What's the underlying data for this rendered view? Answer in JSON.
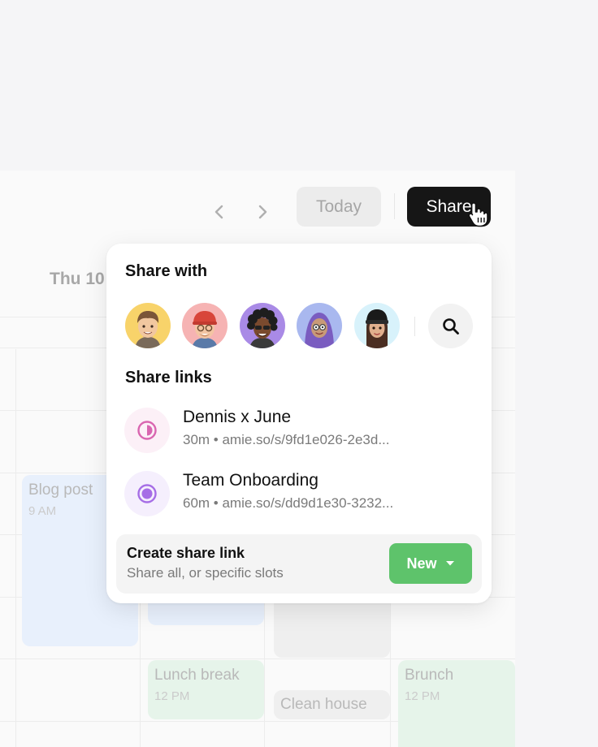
{
  "toolbar": {
    "today_label": "Today",
    "share_label": "Share"
  },
  "calendar": {
    "day_label": "Thu 10",
    "events": [
      {
        "title": "Blog post",
        "time": "9 AM",
        "color": "#e8f0fc"
      },
      {
        "title": "Lunch break",
        "time": "12 PM",
        "color": "#e6f4ea"
      },
      {
        "title": "Clean house",
        "time": "",
        "color": "#efefef"
      },
      {
        "title": "Brunch",
        "time": "12 PM",
        "color": "#e6f4ea"
      }
    ]
  },
  "popover": {
    "share_with_title": "Share with",
    "avatars": [
      {
        "icon": "memoji-man-avatar",
        "bg": "#f8d36a"
      },
      {
        "icon": "memoji-red-cap-avatar",
        "bg": "#f6b3b3"
      },
      {
        "icon": "memoji-curly-hair-avatar",
        "bg": "#a98ae6"
      },
      {
        "icon": "memoji-hijab-avatar",
        "bg": "#a9b8ef"
      },
      {
        "icon": "memoji-beanie-avatar",
        "bg": "#d8f2fb"
      }
    ],
    "search_icon": "search-icon",
    "share_links_title": "Share links",
    "links": [
      {
        "name": "Dennis x June",
        "meta": "30m • amie.so/s/9fd1e026-2e3d...",
        "color": "#d966b0"
      },
      {
        "name": "Team Onboarding",
        "meta": "60m • amie.so/s/dd9d1e30-3232...",
        "color": "#a66ee6"
      }
    ],
    "create": {
      "title": "Create share link",
      "subtitle": "Share all, or specific slots",
      "new_label": "New"
    }
  },
  "colors": {
    "accent_green": "#5ec36b",
    "share_button": "#161616"
  }
}
